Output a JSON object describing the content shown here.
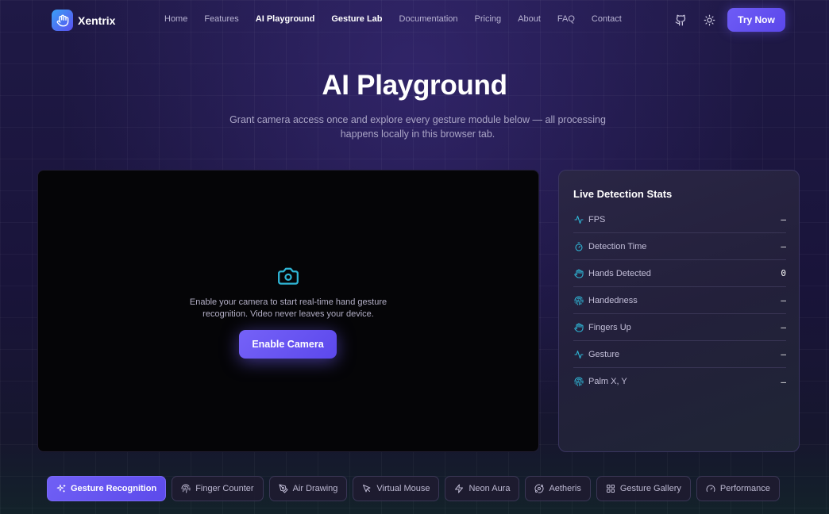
{
  "brand": {
    "name": "Xentrix"
  },
  "nav": {
    "links": [
      {
        "label": "Home",
        "active": false
      },
      {
        "label": "Features",
        "active": false
      },
      {
        "label": "AI Playground",
        "active": true
      },
      {
        "label": "Gesture Lab",
        "active": true
      },
      {
        "label": "Documentation",
        "active": false
      },
      {
        "label": "Pricing",
        "active": false
      },
      {
        "label": "About",
        "active": false
      },
      {
        "label": "FAQ",
        "active": false
      },
      {
        "label": "Contact",
        "active": false
      }
    ],
    "cta_label": "Try Now"
  },
  "hero": {
    "title": "AI Playground",
    "subtitle": "Grant camera access once and explore every gesture module below — all processing happens locally in this browser tab."
  },
  "camera": {
    "message": "Enable your camera to start real-time hand gesture recognition. Video never leaves your device.",
    "button_label": "Enable Camera"
  },
  "stats": {
    "title": "Live Detection Stats",
    "rows": [
      {
        "icon": "pulse-icon",
        "label": "FPS",
        "value": "—"
      },
      {
        "icon": "timer-icon",
        "label": "Detection Time",
        "value": "—"
      },
      {
        "icon": "hand-icon",
        "label": "Hands Detected",
        "value": "0"
      },
      {
        "icon": "fingerprint-icon",
        "label": "Handedness",
        "value": "—"
      },
      {
        "icon": "hand-icon",
        "label": "Fingers Up",
        "value": "—"
      },
      {
        "icon": "pulse-icon",
        "label": "Gesture",
        "value": "—"
      },
      {
        "icon": "fingerprint-icon",
        "label": "Palm X, Y",
        "value": "—"
      }
    ]
  },
  "tabs": [
    {
      "icon": "sparkles-icon",
      "label": "Gesture Recognition",
      "active": true
    },
    {
      "icon": "fingerprint-icon",
      "label": "Finger Counter",
      "active": false
    },
    {
      "icon": "pen-icon",
      "label": "Air Drawing",
      "active": false
    },
    {
      "icon": "cursor-icon",
      "label": "Virtual Mouse",
      "active": false
    },
    {
      "icon": "bolt-icon",
      "label": "Neon Aura",
      "active": false
    },
    {
      "icon": "orbit-icon",
      "label": "Aetheris",
      "active": false
    },
    {
      "icon": "grid-icon",
      "label": "Gesture Gallery",
      "active": false
    },
    {
      "icon": "gauge-icon",
      "label": "Performance",
      "active": false
    }
  ],
  "colors": {
    "accent": "#6e5cf6",
    "icon_cyan": "#2fb6d6",
    "panel_bg": "#050507"
  }
}
